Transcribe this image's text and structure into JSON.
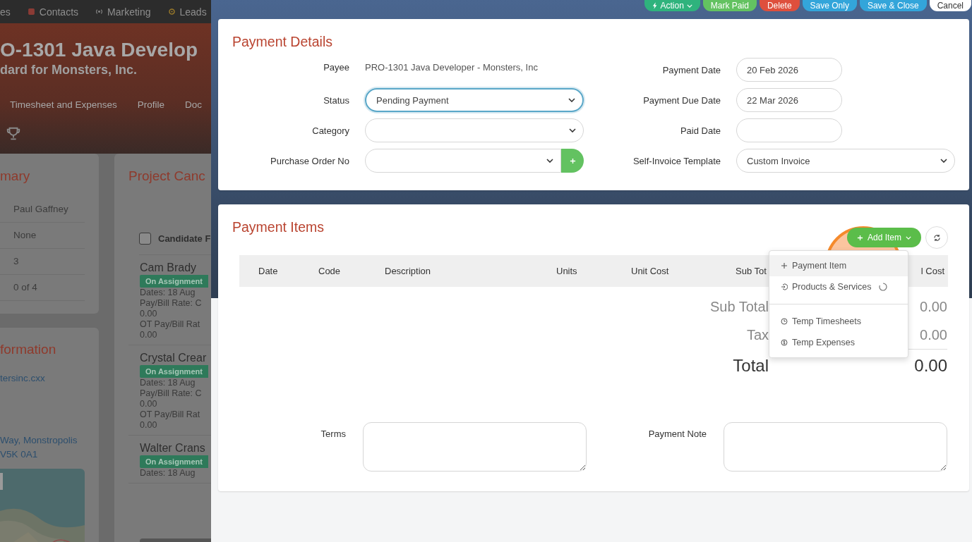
{
  "background_page": {
    "nav_items": [
      {
        "label": "es",
        "kind": "plain"
      },
      {
        "label": "Contacts",
        "kind": "contacts"
      },
      {
        "label": "Marketing",
        "kind": "signal"
      },
      {
        "label": "Leads",
        "kind": "target"
      }
    ],
    "title": "O-1301 Java Develop",
    "subtitle": "dard for Monsters, Inc.",
    "tabs": [
      "Timesheet and Expenses",
      "Profile",
      "Doc"
    ],
    "summary": {
      "title": "mary",
      "rows": [
        "Paul Gaffney",
        "None",
        "3",
        "0 of 4"
      ]
    },
    "information": {
      "title": "formation",
      "website": "tersinc.cxx",
      "address": [
        "Way, Monstropolis",
        "V5K 0A1"
      ]
    },
    "candidates": {
      "title": "Project Canc",
      "select_all": {
        "label": "Candidate F",
        "checked": false
      },
      "items": [
        {
          "name": "Cam Brady",
          "badge": "On Assignment",
          "lines": [
            "Dates: 18 Aug",
            "Pay/Bill Rate: C",
            "0.00",
            "OT Pay/Bill Rat",
            "0.00"
          ]
        },
        {
          "name": "Crystal Crear",
          "badge": "On Assignment",
          "lines": [
            "Dates: 18 Aug",
            "Pay/Bill Rate: C",
            "0.00",
            "OT Pay/Bill Rat",
            "0.00"
          ]
        },
        {
          "name": "Walter Crans",
          "badge": "On Assignment",
          "lines": [
            "Dates: 18 Aug"
          ]
        }
      ]
    }
  },
  "toolbar": [
    {
      "label": "Action",
      "kind": "action"
    },
    {
      "label": "Mark Paid",
      "kind": "success"
    },
    {
      "label": "Delete",
      "kind": "danger"
    },
    {
      "label": "Save Only",
      "kind": "primary"
    },
    {
      "label": "Save & Close",
      "kind": "primary"
    },
    {
      "label": "Cancel",
      "kind": "plain"
    }
  ],
  "payment_details": {
    "title": "Payment Details",
    "left_fields": [
      {
        "label": "Payee",
        "kind": "text",
        "value": "PRO-1301 Java Developer - Monsters, Inc"
      },
      {
        "label": "Status",
        "kind": "select",
        "value": "Pending Payment",
        "focused": true
      },
      {
        "label": "Category",
        "kind": "select",
        "focused": false
      },
      {
        "label": "Purchase Order No",
        "kind": "select-add",
        "focused": false
      }
    ],
    "right_fields": [
      {
        "label": "Payment Date",
        "kind": "date",
        "value": "20 Feb 2026"
      },
      {
        "label": "Payment Due Date",
        "kind": "date",
        "value": "22 Mar 2026"
      },
      {
        "label": "Paid Date",
        "kind": "date"
      },
      {
        "label": "Self-Invoice Template",
        "kind": "select",
        "value": "Custom Invoice"
      }
    ]
  },
  "payment_items": {
    "title": "Payment Items",
    "add_button": "Add Item",
    "columns": [
      "Date",
      "Code",
      "Description",
      "Units",
      "Unit Cost",
      "Sub Tot",
      "l Cost"
    ],
    "totals": [
      {
        "label": "Sub Total",
        "value": "0.00",
        "kind": "sub"
      },
      {
        "label": "Tax",
        "value": "0.00",
        "kind": "sub"
      },
      {
        "label": "Total",
        "value": "0.00",
        "kind": "grand"
      }
    ],
    "terms_label": "Terms",
    "note_label": "Payment Note",
    "add_menu": [
      {
        "label": "Payment Item",
        "kind": "plus",
        "selected": true,
        "loading": false,
        "divider_after": false
      },
      {
        "label": "Products & Services",
        "kind": "login",
        "selected": false,
        "loading": true,
        "divider_after": true
      },
      {
        "label": "Temp Timesheets",
        "kind": "clock",
        "selected": false,
        "loading": false,
        "divider_after": false
      },
      {
        "label": "Temp Expenses",
        "kind": "dollar",
        "selected": false,
        "loading": false,
        "divider_after": false
      }
    ]
  }
}
